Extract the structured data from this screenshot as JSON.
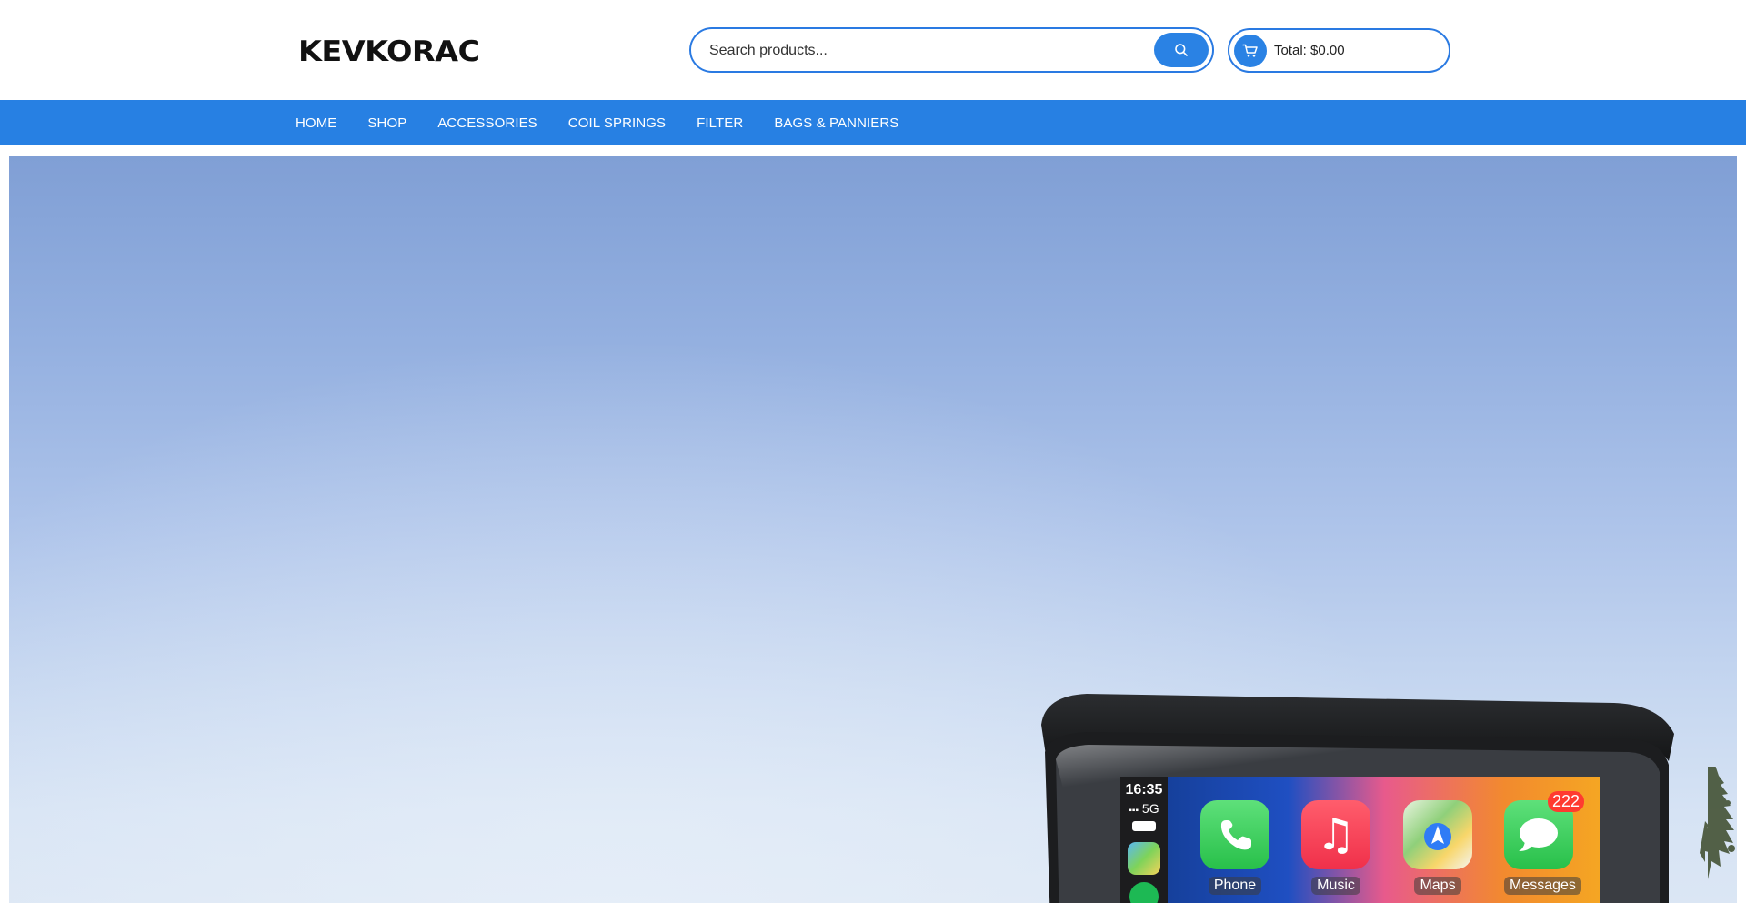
{
  "header": {
    "logo_text": "KEVKORAC",
    "search": {
      "placeholder": "Search products...",
      "value": ""
    },
    "cart": {
      "total_label": "Total: $0.00"
    }
  },
  "nav": {
    "items": [
      "HOME",
      "SHOP",
      "ACCESSORIES",
      "COIL SPRINGS",
      "FILTER",
      "BAGS & PANNIERS"
    ]
  },
  "hero": {
    "screen": {
      "time": "16:35",
      "network": "5G",
      "apps": [
        {
          "name": "Phone",
          "icon": "phone-app-icon",
          "color": "#32c759"
        },
        {
          "name": "Music",
          "icon": "music-app-icon",
          "color": "#f53b55"
        },
        {
          "name": "Maps",
          "icon": "maps-app-icon",
          "color": "#59b7f5"
        },
        {
          "name": "Messages",
          "icon": "messages-app-icon",
          "color": "#32c759",
          "badge": "222"
        }
      ]
    }
  },
  "colors": {
    "accent": "#2780e3",
    "badge": "#ff3b30"
  }
}
